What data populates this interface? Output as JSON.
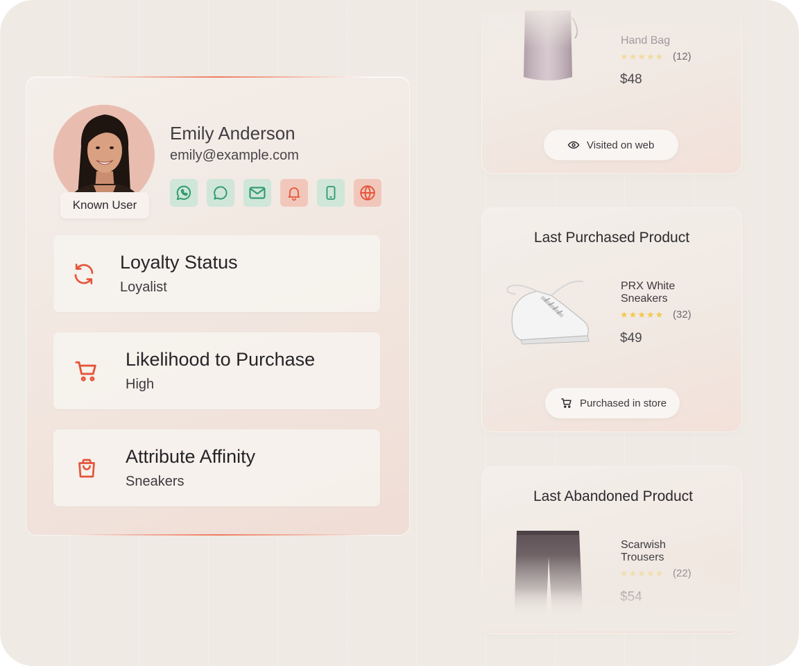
{
  "profile": {
    "name": "Emily Anderson",
    "email": "emily@example.com",
    "badge": "Known User",
    "channels": [
      {
        "icon": "whatsapp-icon",
        "tone": "green",
        "color": "#2f9a6b"
      },
      {
        "icon": "chat-bubble-icon",
        "tone": "green",
        "color": "#2f9a6b"
      },
      {
        "icon": "mail-icon",
        "tone": "green",
        "color": "#2f9a6b"
      },
      {
        "icon": "bell-icon",
        "tone": "red",
        "color": "#e4553a"
      },
      {
        "icon": "mobile-icon",
        "tone": "green",
        "color": "#2f9a6b"
      },
      {
        "icon": "globe-icon",
        "tone": "red",
        "color": "#e4553a"
      }
    ]
  },
  "attributes": [
    {
      "title": "Loyalty Status",
      "value": "Loyalist",
      "icon": "refresh-icon"
    },
    {
      "title": "Likelihood to Purchase",
      "value": "High",
      "icon": "cart-icon"
    },
    {
      "title": "Attribute Affinity",
      "value": "Sneakers",
      "icon": "shopping-bag-icon"
    }
  ],
  "products": [
    {
      "name": "Hand Bag",
      "rating": 5,
      "reviews": "(12)",
      "price": "$48",
      "action": "Visited on web",
      "action_icon": "eye-icon"
    },
    {
      "heading": "Last Purchased Product",
      "name_line1": "PRX White",
      "name_line2": "Sneakers",
      "rating": 5,
      "reviews": "(32)",
      "price": "$49",
      "action": "Purchased in store",
      "action_icon": "cart-icon"
    },
    {
      "heading": "Last Abandoned Product",
      "name_line1": "Scarwish",
      "name_line2": "Trousers",
      "rating": 5,
      "reviews": "(22)",
      "price": "$54"
    }
  ],
  "colors": {
    "accent": "#e4553a",
    "channel_green": "#2f9a6b",
    "star": "#f2c94c",
    "background": "#efeae4"
  }
}
